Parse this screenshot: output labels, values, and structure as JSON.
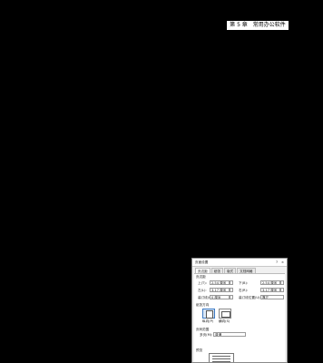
{
  "page": {
    "chapter_tag": "第 5 章　常用办公软件"
  },
  "dialog": {
    "title": "页面设置",
    "help": "?",
    "close": "×",
    "tabs": [
      "页边距",
      "纸张",
      "版式",
      "文档网格"
    ],
    "margins_section": "页边距",
    "top_label": "上(T):",
    "top_value": "2.54 厘米",
    "bottom_label": "下(B):",
    "bottom_value": "2.54 厘米",
    "left_label": "左(L):",
    "left_value": "3.17 厘米",
    "right_label": "右(R):",
    "right_value": "3.17 厘米",
    "gutter_label": "装订线(G):",
    "gutter_value": "0 厘米",
    "gutter_pos_label": "装订线位置(U):",
    "gutter_pos_value": "靠左",
    "orientation_section": "纸张方向",
    "portrait_label": "纵向(P)",
    "landscape_label": "横向(S)",
    "pages_section": "页码范围",
    "multiple_pages_label": "多页(M):",
    "multiple_pages_value": "普通",
    "preview_section": "预览"
  },
  "colors": {
    "background": "#000000",
    "dialog": "#f0f0f0",
    "selection": "#3a78c2"
  }
}
